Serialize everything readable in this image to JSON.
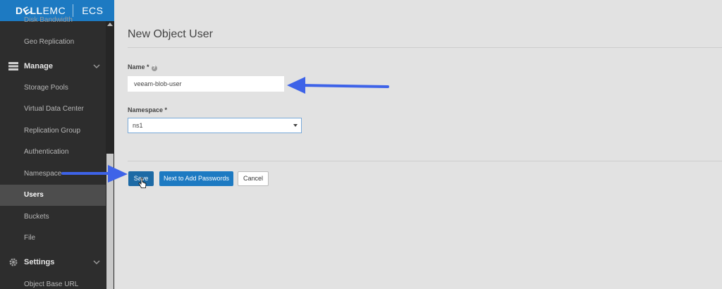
{
  "brand": {
    "logo_text": "DELLEMC",
    "product": "ECS"
  },
  "sidebar": {
    "cut_item": "Disk Bandwidth",
    "items_top": [
      "Geo Replication"
    ],
    "manage_group": "Manage",
    "manage_items": [
      "Storage Pools",
      "Virtual Data Center",
      "Replication Group",
      "Authentication",
      "Namespace",
      "Users",
      "Buckets",
      "File"
    ],
    "active_item": "Users",
    "settings_group": "Settings",
    "settings_items": [
      "Object Base URL"
    ]
  },
  "main": {
    "title": "New Object User",
    "name_label": "Name *",
    "name_value": "veeam-blob-user",
    "namespace_label": "Namespace *",
    "namespace_value": "ns1",
    "buttons": {
      "save": "Save",
      "next": "Next to Add Passwords",
      "cancel": "Cancel"
    }
  },
  "colors": {
    "brand_blue": "#1d7ac2",
    "sidebar_bg": "#2d2d2d",
    "annotation_arrow": "#3e63e8"
  },
  "icons": [
    "help-icon",
    "manage-icon",
    "settings-icon",
    "chevron-down-icon",
    "annotation-arrow",
    "hand-cursor-icon"
  ]
}
